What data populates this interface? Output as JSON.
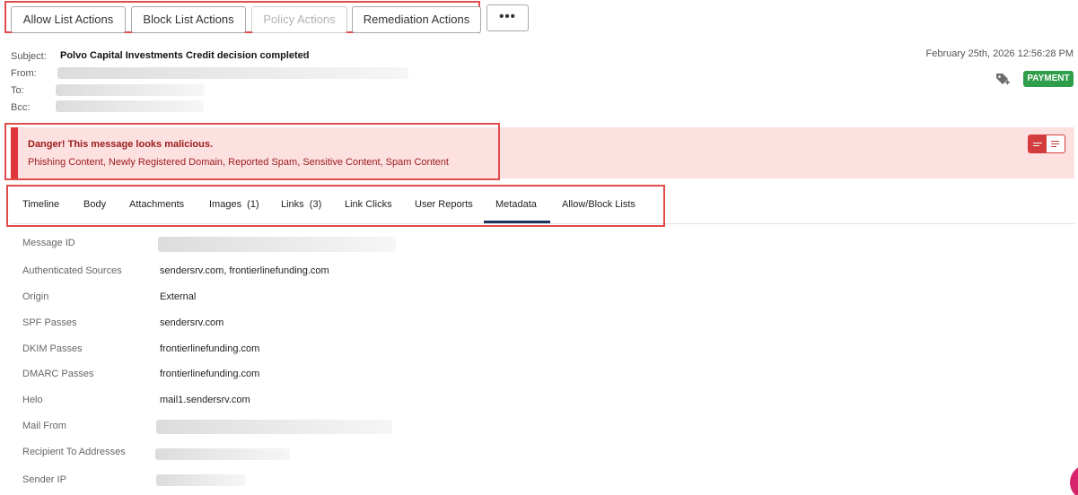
{
  "toolbar": {
    "allow_list": "Allow List Actions",
    "block_list": "Block List Actions",
    "policy": "Policy Actions",
    "remediation": "Remediation Actions",
    "more": "•••"
  },
  "header": {
    "subject_label": "Subject:",
    "subject": "Polvo Capital Investments Credit decision completed",
    "from_label": "From:",
    "to_label": "To:",
    "bcc_label": "Bcc:",
    "date": "February 25th, 2026 12:56:28 PM",
    "badge": "PAYMENT"
  },
  "banner": {
    "title": "Danger!  This message looks malicious.",
    "text": "Phishing Content, Newly Registered Domain, Reported Spam, Sensitive Content, Spam Content"
  },
  "tabs": [
    "Timeline",
    "Body",
    "Attachments",
    "Images  (1)",
    "Links  (3)",
    "Link Clicks",
    "User Reports",
    "Metadata",
    "Allow/Block Lists"
  ],
  "metadata": {
    "message_id": {
      "label": "Message ID"
    },
    "authenticated_sources": {
      "label": "Authenticated Sources",
      "value": "sendersrv.com, frontierlinefunding.com"
    },
    "origin": {
      "label": "Origin",
      "value": "External"
    },
    "spf": {
      "label": "SPF Passes",
      "value": "sendersrv.com"
    },
    "dkim": {
      "label": "DKIM Passes",
      "value": "frontierlinefunding.com"
    },
    "dmarc": {
      "label": "DMARC Passes",
      "value": "frontierlinefunding.com"
    },
    "helo": {
      "label": "Helo",
      "value": "mail1.sendersrv.com"
    },
    "mail_from": {
      "label": "Mail From"
    },
    "recipient_to": {
      "label": "Recipient To Addresses"
    },
    "sender_ip": {
      "label": "Sender IP"
    }
  },
  "colors": {
    "danger": "#e0353a",
    "badge": "#2e9e4a",
    "tab_active": "#1d3461"
  }
}
